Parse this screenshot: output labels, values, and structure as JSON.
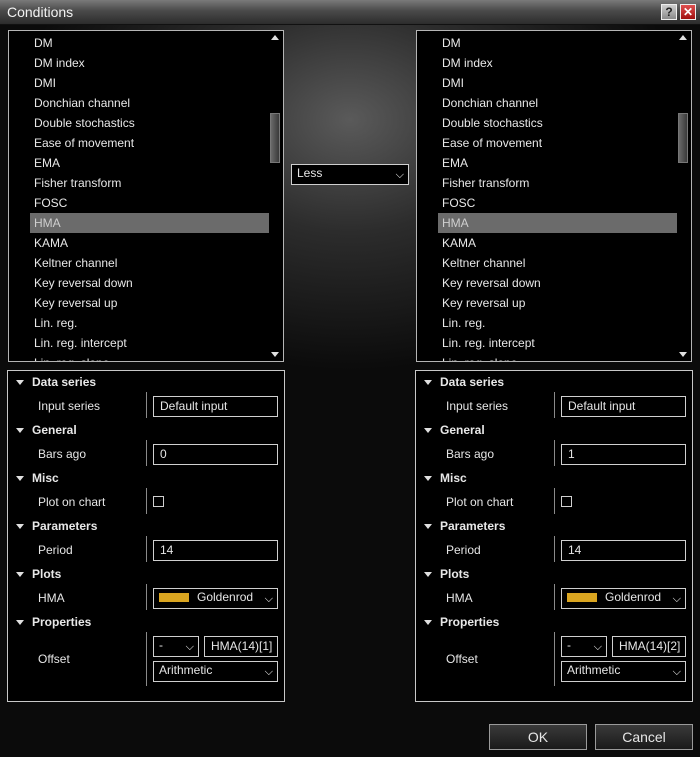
{
  "window": {
    "title": "Conditions",
    "help_label": "?",
    "close_label": "✕"
  },
  "indicators": [
    "DM",
    "DM index",
    "DMI",
    "Donchian channel",
    "Double stochastics",
    "Ease of movement",
    "EMA",
    "Fisher transform",
    "FOSC",
    "HMA",
    "KAMA",
    "Keltner channel",
    "Key reversal down",
    "Key reversal up",
    "Lin. reg.",
    "Lin. reg. intercept",
    "Lin. reg. slope"
  ],
  "left_list": {
    "selected": "HMA"
  },
  "right_list": {
    "selected": "HMA"
  },
  "operator": {
    "value": "Less"
  },
  "left_props": {
    "cat_data_series": "Data series",
    "input_series_label": "Input series",
    "input_series_value": "Default input",
    "cat_general": "General",
    "bars_ago_label": "Bars ago",
    "bars_ago_value": "0",
    "cat_misc": "Misc",
    "plot_on_chart_label": "Plot on chart",
    "plot_on_chart_checked": false,
    "cat_parameters": "Parameters",
    "period_label": "Period",
    "period_value": "14",
    "cat_plots": "Plots",
    "plot_label": "HMA",
    "plot_color_name": "Goldenrod",
    "plot_color": "#DAA520",
    "cat_properties": "Properties",
    "offset_label": "Offset",
    "offset_sign": "-",
    "offset_expr": "HMA(14)[1]",
    "offset_type": "Arithmetic"
  },
  "right_props": {
    "cat_data_series": "Data series",
    "input_series_label": "Input series",
    "input_series_value": "Default input",
    "cat_general": "General",
    "bars_ago_label": "Bars ago",
    "bars_ago_value": "1",
    "cat_misc": "Misc",
    "plot_on_chart_label": "Plot on chart",
    "plot_on_chart_checked": false,
    "cat_parameters": "Parameters",
    "period_label": "Period",
    "period_value": "14",
    "cat_plots": "Plots",
    "plot_label": "HMA",
    "plot_color_name": "Goldenrod",
    "plot_color": "#DAA520",
    "cat_properties": "Properties",
    "offset_label": "Offset",
    "offset_sign": "-",
    "offset_expr": "HMA(14)[2]",
    "offset_type": "Arithmetic"
  },
  "buttons": {
    "ok": "OK",
    "cancel": "Cancel"
  }
}
